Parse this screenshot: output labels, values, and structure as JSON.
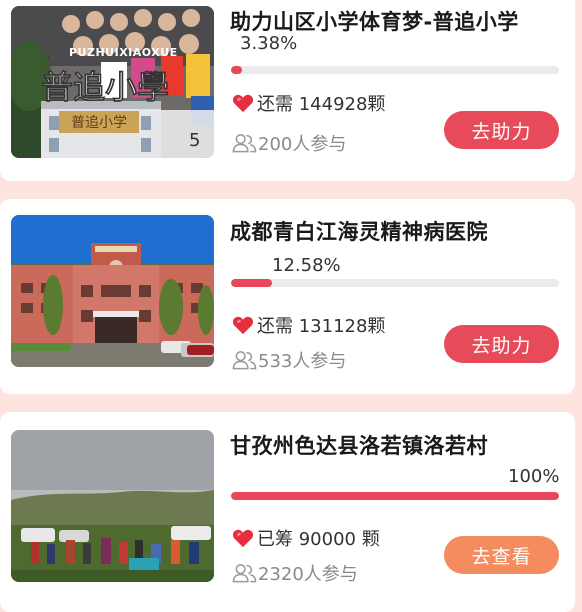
{
  "projects": [
    {
      "title": "助力山区小学体育梦-普追小学",
      "percent_text": "3.38%",
      "progress": 0.0338,
      "need_text": "还需 144928颗",
      "participants_text": "200人参与",
      "button_label": "去助力",
      "image_caption_latin": "PUZHUIXIAOXUE",
      "image_caption_cn": "普追小學",
      "image_sign": "普追小学",
      "image_badge": "5"
    },
    {
      "title": "成都青白江海灵精神病医院",
      "percent_text": "12.58%",
      "progress": 0.1258,
      "need_text": "还需 131128颗",
      "participants_text": "533人参与",
      "button_label": "去助力"
    },
    {
      "title": "甘孜州色达县洛若镇洛若村",
      "percent_text": "100%",
      "progress": 1.0,
      "need_text": "已筹 90000 颗",
      "participants_text": "2320人参与",
      "button_label": "去查看"
    }
  ],
  "colors": {
    "accent_red": "#e74b5a",
    "accent_orange": "#f48c60",
    "progress_fill": "#e9465a",
    "page_bg": "#fde4de"
  }
}
